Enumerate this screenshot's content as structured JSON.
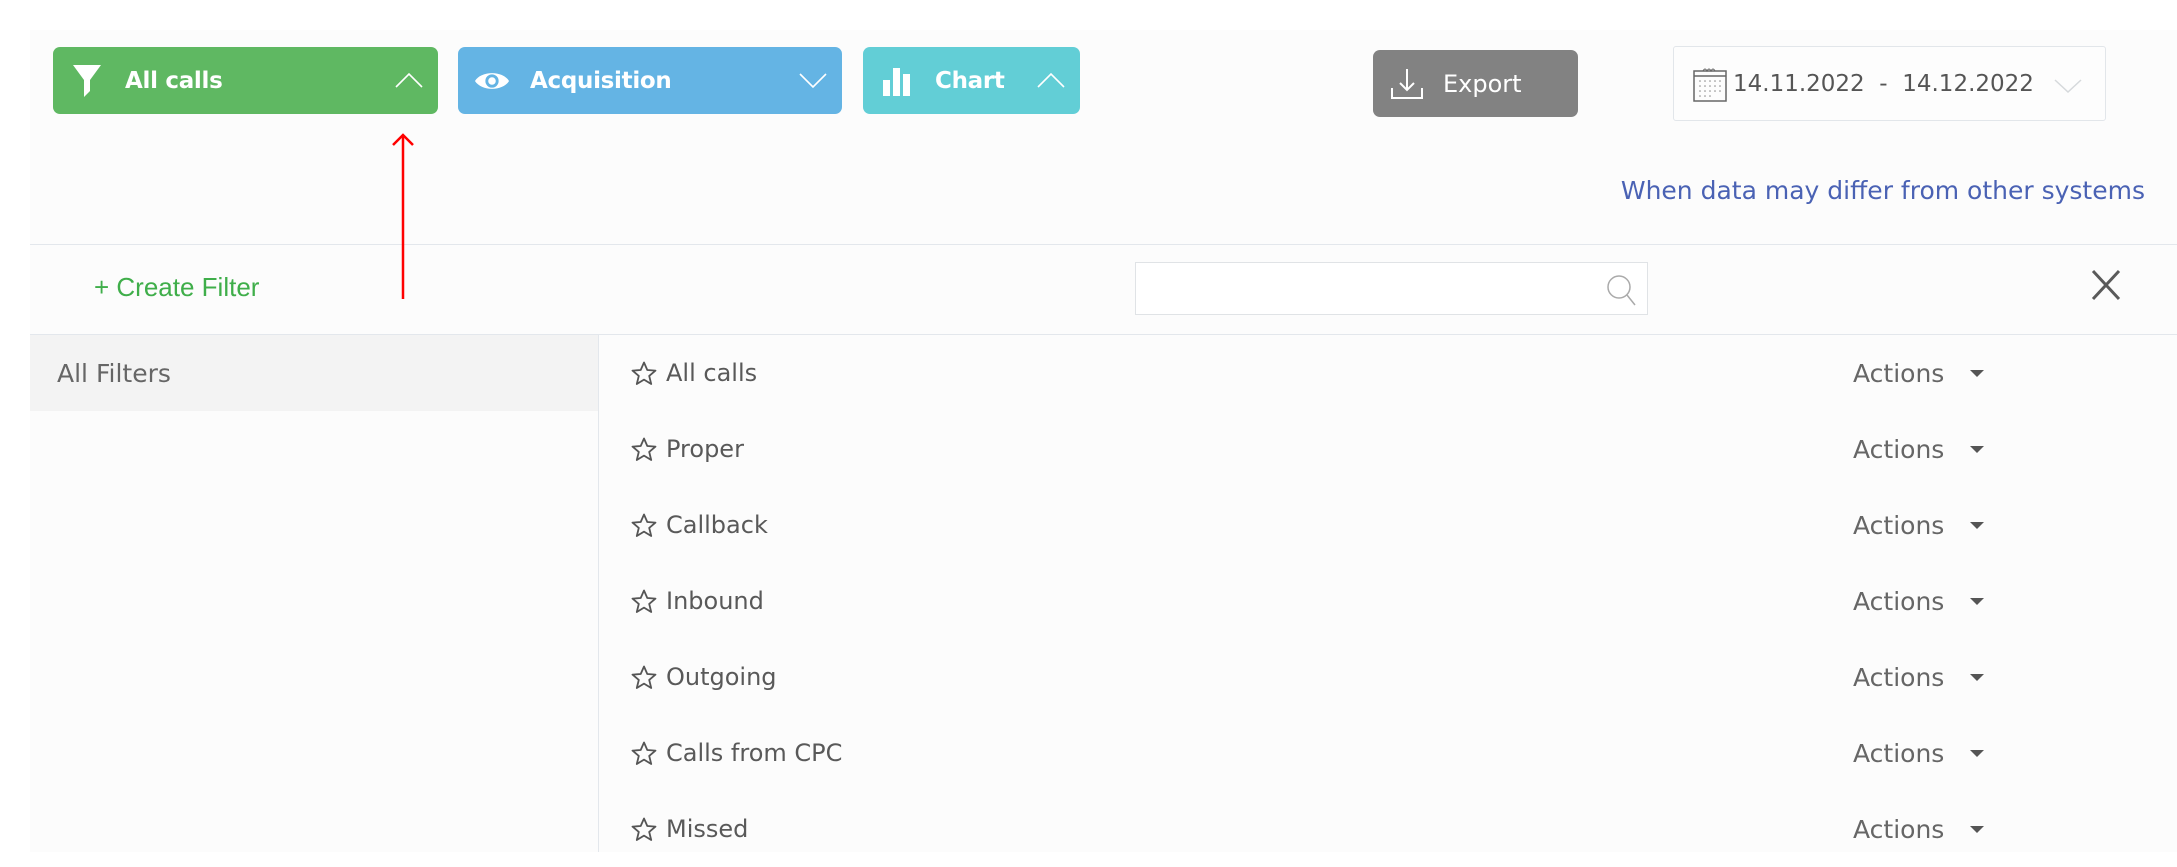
{
  "toolbar": {
    "filter_button": {
      "label": "All calls",
      "icon": "funnel-icon",
      "state": "expanded",
      "color": "#5fb862"
    },
    "acquisition_button": {
      "label": "Acquisition",
      "icon": "eye-icon",
      "state": "collapsed",
      "color": "#64b4e4"
    },
    "chart_button": {
      "label": "Chart",
      "icon": "bar-chart-icon",
      "state": "expanded",
      "color": "#62ced6"
    },
    "export_button": {
      "label": "Export",
      "icon": "download-icon",
      "color": "#828282"
    },
    "date_range": {
      "from": "14.11.2022",
      "to": "14.12.2022",
      "display": "14.11.2022  -  14.12.2022",
      "icon": "calendar-icon"
    }
  },
  "notice_link": {
    "label": "When data may differ from other systems",
    "color": "#4a62b4"
  },
  "filter_panel": {
    "create_filter_label": "+ Create Filter",
    "search": {
      "value": "",
      "placeholder": "",
      "icon": "search-icon"
    },
    "close_icon": "close-icon",
    "sidebar": {
      "items": [
        {
          "label": "All Filters",
          "selected": true
        }
      ]
    },
    "filters": [
      {
        "name": "All calls",
        "actions_label": "Actions",
        "favorite": false
      },
      {
        "name": "Proper",
        "actions_label": "Actions",
        "favorite": false
      },
      {
        "name": "Callback",
        "actions_label": "Actions",
        "favorite": false
      },
      {
        "name": "Inbound",
        "actions_label": "Actions",
        "favorite": false
      },
      {
        "name": "Outgoing",
        "actions_label": "Actions",
        "favorite": false
      },
      {
        "name": "Calls from CPC",
        "actions_label": "Actions",
        "favorite": false
      },
      {
        "name": "Missed",
        "actions_label": "Actions",
        "favorite": false
      }
    ]
  },
  "annotation": {
    "type": "arrow",
    "color": "#ff0000",
    "points_to": "filter-button-chevron"
  }
}
